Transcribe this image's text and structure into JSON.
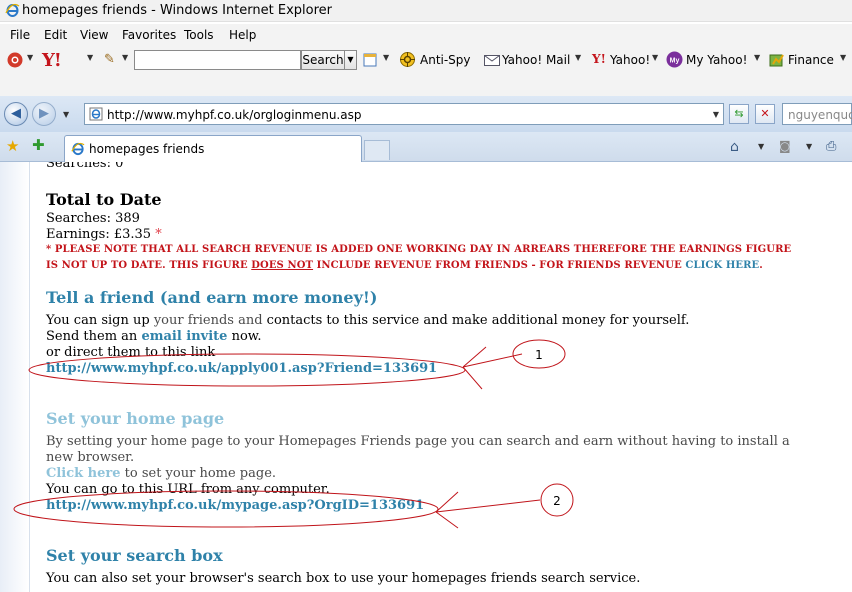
{
  "window": {
    "title": "homepages friends - Windows Internet Explorer"
  },
  "menu": [
    "File",
    "Edit",
    "View",
    "Favorites",
    "Tools",
    "Help"
  ],
  "yahoo_toolbar": {
    "search_button": "Search",
    "items": [
      "Anti-Spy",
      "Yahoo! Mail",
      "Yahoo!",
      "My Yahoo!",
      "Finance"
    ]
  },
  "address_bar": {
    "url": "http://www.myhpf.co.uk/orgloginmenu.asp",
    "search_placeholder": "nguyenquoc"
  },
  "tab": {
    "label": "homepages friends"
  },
  "page": {
    "searches_partial": "Searches: 0",
    "total_title": "Total to Date",
    "searches_total": "Searches: 389",
    "earnings": "Earnings: £3.35",
    "earnings_star": "*",
    "notice_line1": "* PLEASE NOTE THAT ALL SEARCH REVENUE IS ADDED ONE WORKING DAY IN ARREARS THEREFORE THE EARNINGS FIGURE",
    "notice_line2_a": "IS NOT UP TO DATE. THIS FIGURE ",
    "notice_line2_b": "DOES NOT",
    "notice_line2_c": " INCLUDE REVENUE FROM FRIENDS - FOR FRIENDS REVENUE ",
    "notice_line2_link": "CLICK HERE",
    "notice_line2_d": ".",
    "tell_title": "Tell a friend (and earn more money!)",
    "tell_text_a": "You can sign up ",
    "tell_text_b": "your friends and",
    "tell_text_c": " contacts to this service and make additional money for yourself.",
    "send_prefix": "Send them an ",
    "send_link": "email invite",
    "send_suffix": " now.",
    "direct_text": "or direct them to this link",
    "friend_link": "http://www.myhpf.co.uk/apply001.asp?Friend=133691",
    "home_title": "Set your home page",
    "home_text1": "By setting your home page to your Homepages Friends page you can search and earn without having to install a",
    "home_text2": "new browser.",
    "click_here": "Click here",
    "click_here_suffix": " to set your home page.",
    "goto_text": "You can go to this URL from any computer.",
    "mypage_link": "http://www.myhpf.co.uk/mypage.asp?OrgID=133691",
    "search_title": "Set your search box",
    "search_text": "You can also set your browser's search box to use your homepages friends search service."
  },
  "annotations": {
    "label_1": "1",
    "label_2": "2",
    "color": "#c0141a"
  }
}
